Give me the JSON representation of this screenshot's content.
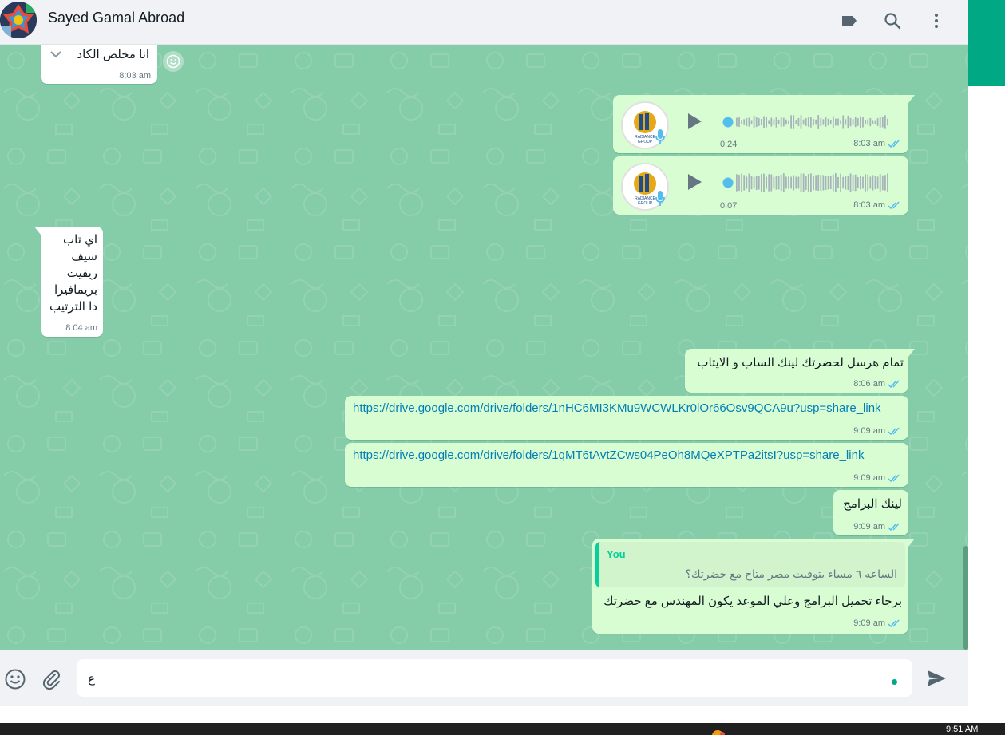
{
  "header": {
    "contact_name": "Sayed Gamal Abroad"
  },
  "messages": {
    "m1": {
      "text": "انا مخلص الكاد",
      "time": "8:03 am"
    },
    "m2": {
      "duration": "0:24",
      "time": "8:03 am"
    },
    "m3": {
      "duration": "0:07",
      "time": "8:03 am"
    },
    "m4": {
      "lines": [
        "اي تاب",
        "سيف",
        "ريفيت",
        "بريمافيرا",
        "دا الترتيب"
      ],
      "time": "8:04 am"
    },
    "m5": {
      "text": "تمام هرسل لحضرتك لينك الساب و الايتاب",
      "time": "8:06 am"
    },
    "m6": {
      "link": "https://drive.google.com/drive/folders/1nHC6MI3KMu9WCWLKr0lOr66Osv9QCA9u?usp=share_link",
      "time": "9:09 am"
    },
    "m7": {
      "link": "https://drive.google.com/drive/folders/1qMT6tAvtZCws04PeOh8MQeXPTPa2itsI?usp=share_link",
      "time": "9:09 am"
    },
    "m8": {
      "text": "لينك البرامج",
      "time": "9:09 am"
    },
    "m9": {
      "quote_author": "You",
      "quote_text": "الساعه ٦ مساء بتوقيت مصر متاح مع حضرتك؟",
      "text": "برجاء تحميل البرامج وعلي الموعد يكون المهندس مع حضرتك",
      "time": "9:09 am"
    }
  },
  "composer": {
    "value": "ع"
  },
  "taskbar": {
    "clock": "9:51 AM"
  },
  "colors": {
    "chat_bg": "#85cca9",
    "outgoing": "#d9fdd3",
    "incoming": "#ffffff",
    "accent": "#00a884",
    "link": "#027eb5",
    "tick": "#53bdeb"
  },
  "icons": {
    "header": [
      "label-icon",
      "search-icon",
      "menu-icon"
    ],
    "composer": [
      "emoji-icon",
      "attach-icon",
      "send-icon"
    ]
  }
}
